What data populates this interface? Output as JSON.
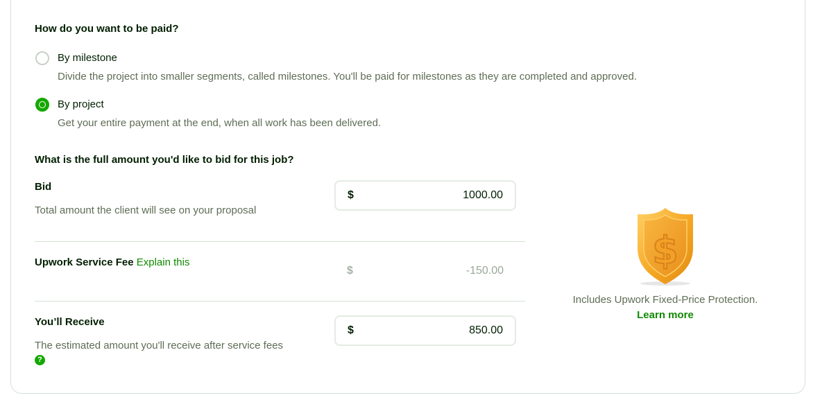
{
  "payment": {
    "question": "How do you want to be paid?",
    "options": [
      {
        "label": "By milestone",
        "description": "Divide the project into smaller segments, called milestones. You'll be paid for milestones as they are completed and approved.",
        "selected": false
      },
      {
        "label": "By project",
        "description": "Get your entire payment at the end, when all work has been delivered.",
        "selected": true
      }
    ]
  },
  "bid": {
    "question": "What is the full amount you'd like to bid for this job?",
    "label": "Bid",
    "description": "Total amount the client will see on your proposal",
    "currency": "$",
    "value": "1000.00"
  },
  "fee": {
    "label": "Upwork Service Fee",
    "link": "Explain this",
    "currency": "$",
    "value": "-150.00"
  },
  "receive": {
    "label": "You’ll Receive",
    "description": "The estimated amount you'll receive after service fees",
    "help_icon": "?",
    "currency": "$",
    "value": "850.00"
  },
  "protection": {
    "icon": "shield-dollar-icon",
    "text": "Includes Upwork Fixed-Price Protection.",
    "link": "Learn more"
  },
  "colors": {
    "accent": "#14a800",
    "link": "#108a00",
    "muted_text": "#5e6d55"
  }
}
